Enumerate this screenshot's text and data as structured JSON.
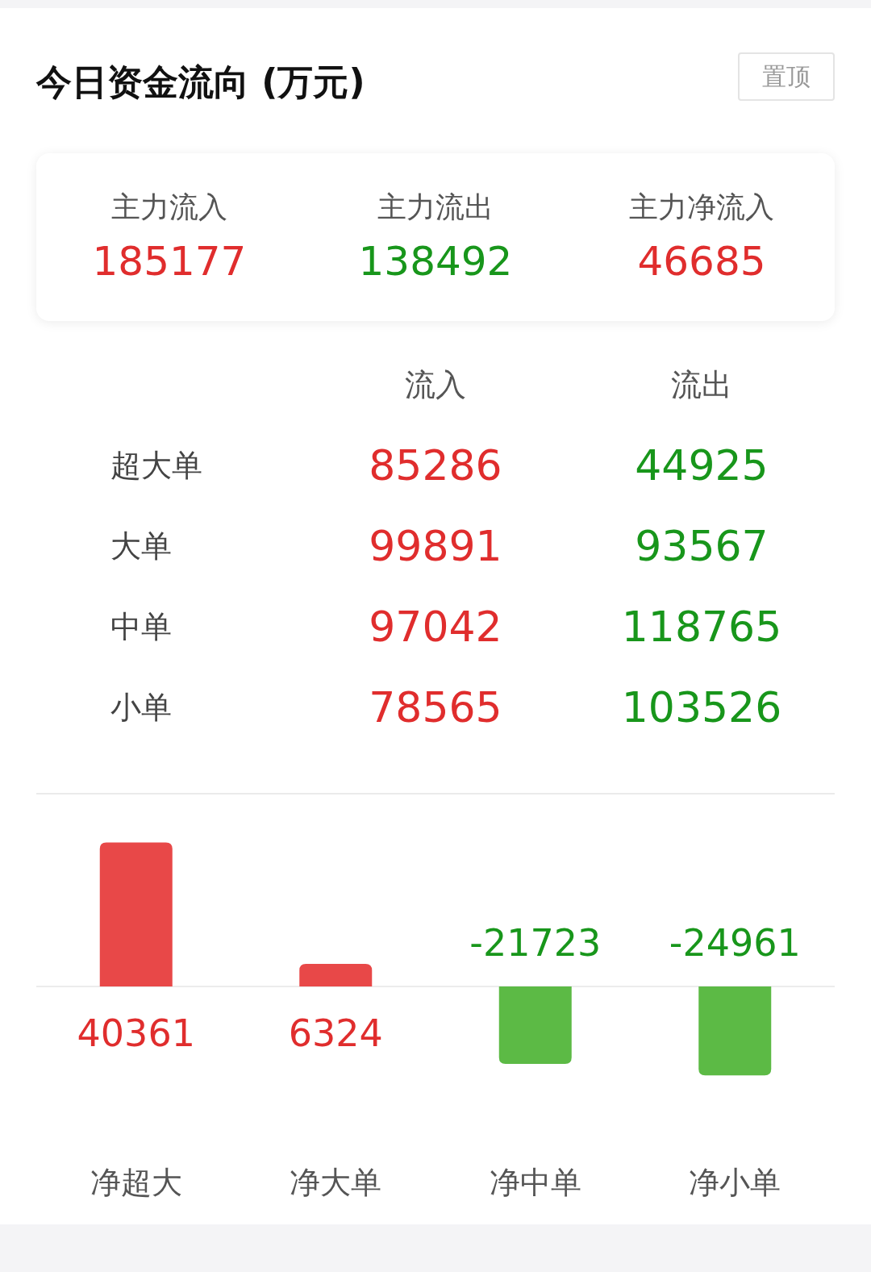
{
  "header": {
    "title": "今日资金流向 (万元)",
    "pin_button": "置顶"
  },
  "summary": [
    {
      "label": "主力流入",
      "value": "185177",
      "kind": "inflow"
    },
    {
      "label": "主力流出",
      "value": "138492",
      "kind": "outflow"
    },
    {
      "label": "主力净流入",
      "value": "46685",
      "kind": "inflow"
    }
  ],
  "table": {
    "columns": [
      {
        "label": "流入",
        "kind": "inflow"
      },
      {
        "label": "流出",
        "kind": "outflow"
      }
    ],
    "rows": [
      {
        "label": "超大单",
        "values": [
          "85286",
          "44925"
        ]
      },
      {
        "label": "大单",
        "values": [
          "99891",
          "93567"
        ]
      },
      {
        "label": "中单",
        "values": [
          "97042",
          "118765"
        ]
      },
      {
        "label": "小单",
        "values": [
          "78565",
          "103526"
        ]
      }
    ]
  },
  "net_chart": {
    "chart_data": {
      "type": "bar",
      "categories": [
        "净超大",
        "净大单",
        "净中单",
        "净小单"
      ],
      "values": [
        40361,
        6324,
        -21723,
        -24961
      ],
      "data_labels": true
    }
  }
}
